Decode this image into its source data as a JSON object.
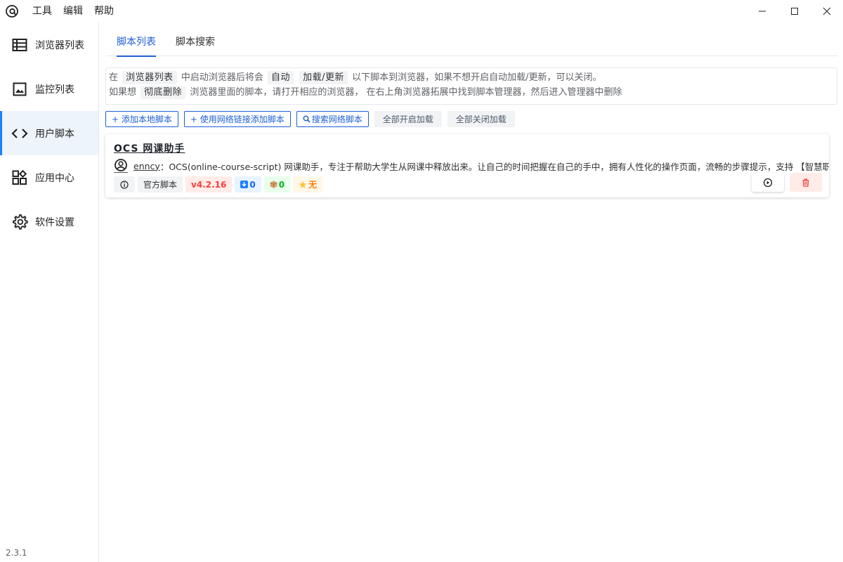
{
  "menu": {
    "tools": "工具",
    "edit": "编辑",
    "help": "帮助"
  },
  "sidebar": {
    "items": [
      {
        "label": "浏览器列表",
        "icon": "list-icon"
      },
      {
        "label": "监控列表",
        "icon": "image-icon"
      },
      {
        "label": "用户脚本",
        "icon": "code-icon"
      },
      {
        "label": "应用中心",
        "icon": "apps-icon"
      },
      {
        "label": "软件设置",
        "icon": "gear-icon"
      }
    ],
    "active_index": 2,
    "version": "2.3.1"
  },
  "tabs": [
    {
      "label": "脚本列表"
    },
    {
      "label": "脚本搜索"
    }
  ],
  "notice": {
    "line1": {
      "t1": "在",
      "c1": "浏览器列表",
      "t2": "中启动浏览器后将会",
      "c2": "自动",
      "c3": "加载/更新",
      "t3": "以下脚本到浏览器，如果不想开启自动加载/更新，可以关闭。"
    },
    "line2": {
      "t1": "如果想",
      "c1": "彻底删除",
      "t2": "浏览器里面的脚本，请打开相应的浏览器， 在右上角浏览器拓展中找到脚本管理器，然后进入管理器中删除"
    }
  },
  "actions": {
    "add_local": "+ 添加本地脚本",
    "add_url": "+ 使用网络链接添加脚本",
    "search_net": "搜索网络脚本",
    "enable_all": "全部开启加载",
    "disable_all": "全部关闭加载"
  },
  "script": {
    "title": "OCS 网课助手",
    "author": "enncy",
    "separator": "：",
    "description": "OCS(online-course-script) 网课助手，专注于帮助大学生从网课中释放出来。让自己的时间把握在自己的手中，拥有人性化的操作页面，流畅的步骤提示，支持 【智慧职教(MOOC",
    "official": "官方脚本",
    "version": "v4.2.16",
    "downloads": "0",
    "box_count": "0",
    "rating": "无"
  },
  "colors": {
    "accent": "#1e5fd6",
    "danger": "#f53f3f",
    "success": "#00b42a",
    "warning": "#ff7d00"
  }
}
